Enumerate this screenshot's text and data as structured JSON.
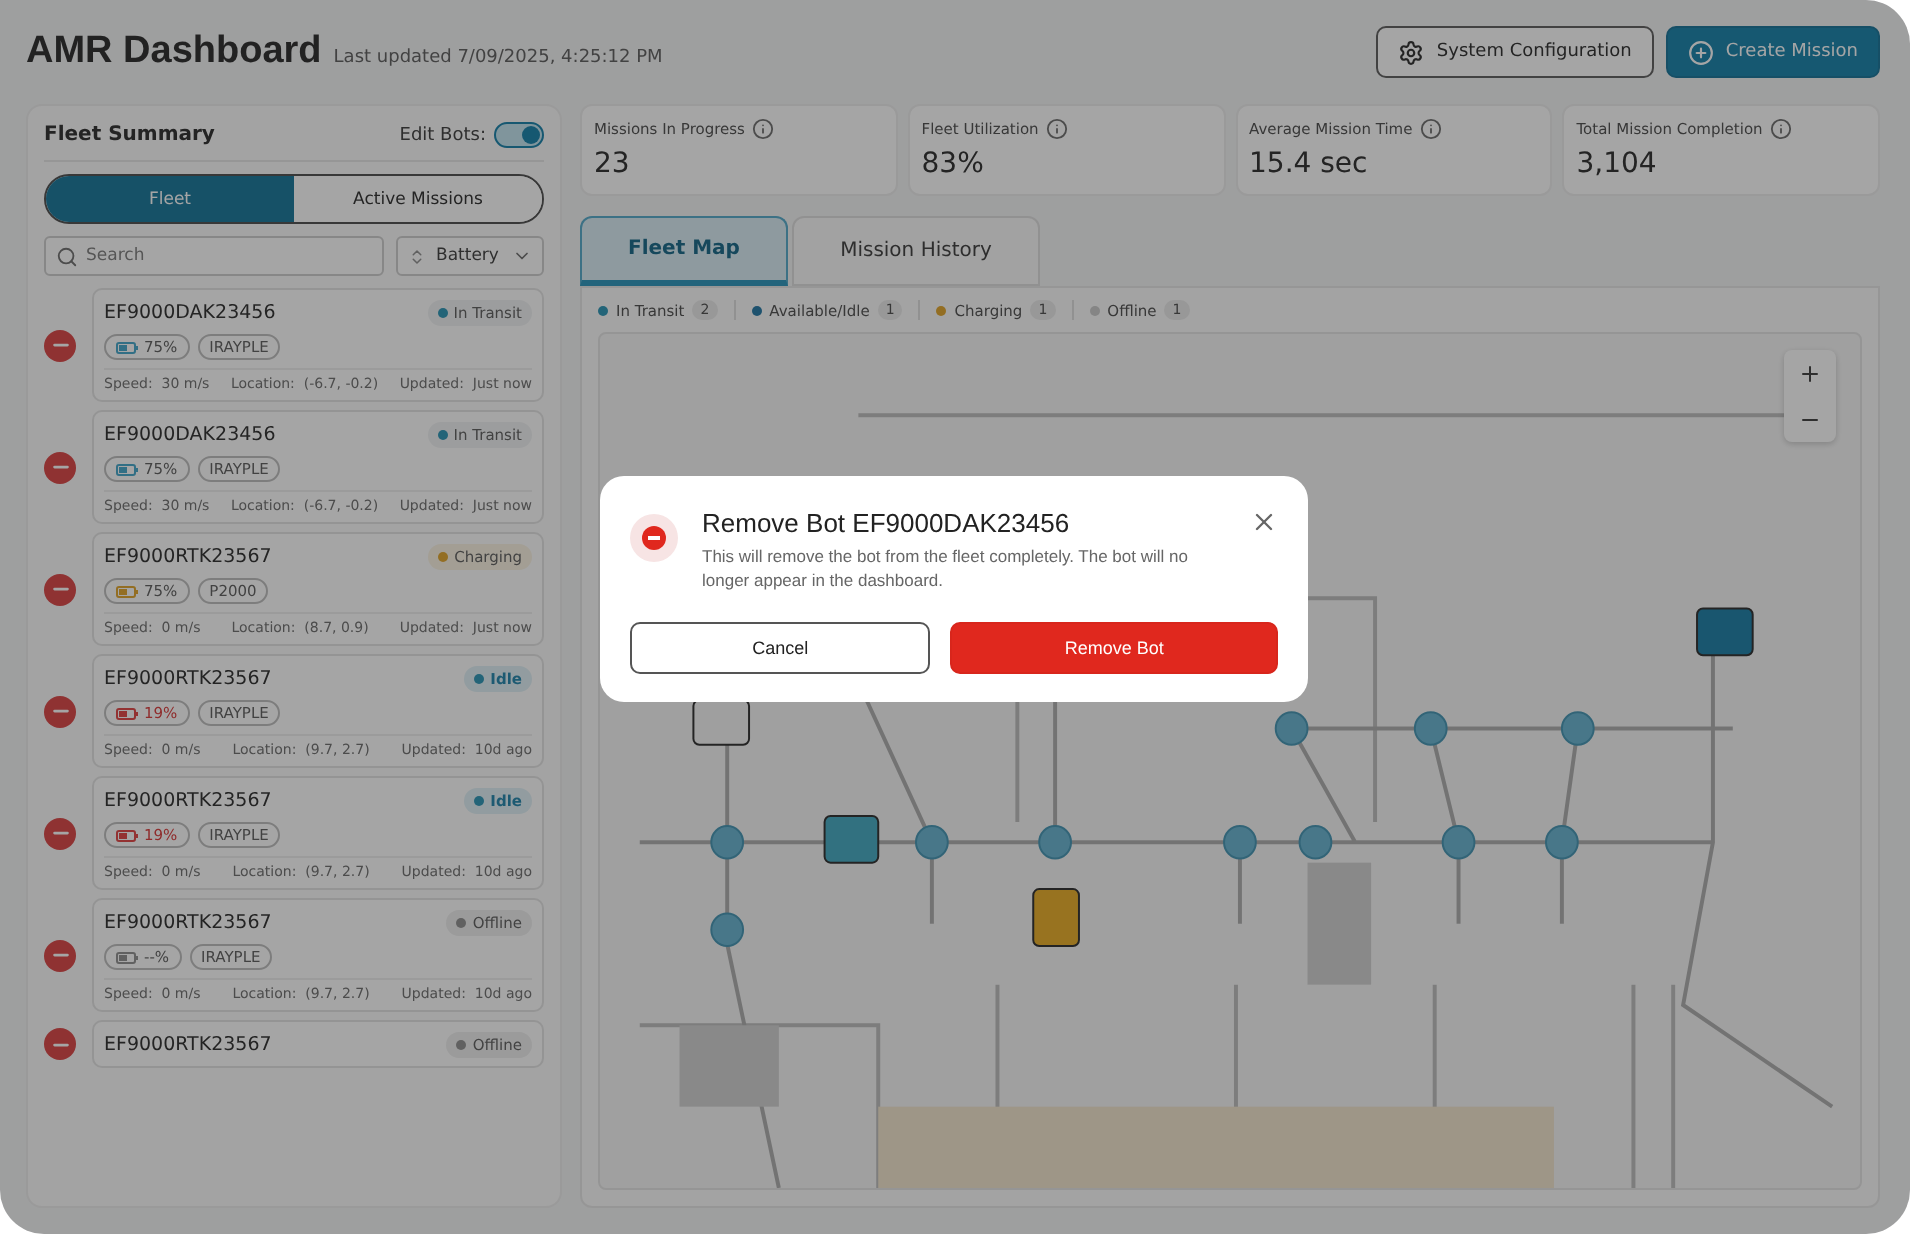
{
  "header": {
    "title": "AMR Dashboard",
    "updated": "Last updated 7/09/2025, 4:25:12 PM",
    "buttons": [
      {
        "label": "System Configuration",
        "kind": "outline"
      },
      {
        "label": "Create Mission",
        "kind": "primary"
      }
    ]
  },
  "fleet": {
    "title": "Fleet Summary",
    "edit_label": "Edit Bots:",
    "edit_on": true,
    "tabs": [
      {
        "label": "Fleet",
        "selected": true
      },
      {
        "label": "Active Missions",
        "selected": false
      }
    ],
    "search": {
      "placeholder": "Search"
    },
    "sort": {
      "value": "Battery"
    },
    "bots": [
      {
        "name": "EF9000DAK23456",
        "status": {
          "label": "In Transit",
          "kind": "transit",
          "color": "#236478"
        },
        "battery": {
          "text": "75%",
          "color": "#326f85",
          "low": false
        },
        "model": "IRAYPLE",
        "speed": "Speed:  30 m/s",
        "location": "Location:  (-6.7, -0.2)",
        "updated": "Updated:  Just now"
      },
      {
        "name": "EF9000DAK23456",
        "status": {
          "label": "In Transit",
          "kind": "transit",
          "color": "#236478"
        },
        "battery": {
          "text": "75%",
          "color": "#326f85",
          "low": false
        },
        "model": "IRAYPLE",
        "speed": "Speed:  30 m/s",
        "location": "Location:  (-6.7, -0.2)",
        "updated": "Updated:  Just now"
      },
      {
        "name": "EF9000RTK23567",
        "status": {
          "label": "Charging",
          "kind": "charging",
          "color": "#936e23"
        },
        "battery": {
          "text": "75%",
          "color": "#936e23",
          "low": false
        },
        "model": "P2000",
        "speed": "Speed:  0 m/s",
        "location": "Location:  (8.7, 0.9)",
        "updated": "Updated:  Just now"
      },
      {
        "name": "EF9000RTK23567",
        "status": {
          "label": "Idle",
          "kind": "idle",
          "color": "#236478"
        },
        "battery": {
          "text": "19%",
          "color": "#933232",
          "low": true
        },
        "model": "IRAYPLE",
        "speed": "Speed:  0 m/s",
        "location": "Location:  (9.7, 2.7)",
        "updated": "Updated:  10d ago"
      },
      {
        "name": "EF9000RTK23567",
        "status": {
          "label": "Idle",
          "kind": "idle",
          "color": "#236478"
        },
        "battery": {
          "text": "19%",
          "color": "#933232",
          "low": true
        },
        "model": "IRAYPLE",
        "speed": "Speed:  0 m/s",
        "location": "Location:  (9.7, 2.7)",
        "updated": "Updated:  10d ago"
      },
      {
        "name": "EF9000RTK23567",
        "status": {
          "label": "Offline",
          "kind": "offline",
          "color": "#616161"
        },
        "battery": {
          "text": "--%",
          "color": "#616161",
          "low": false
        },
        "model": "IRAYPLE",
        "speed": "Speed:  0 m/s",
        "location": "Location:  (9.7, 2.7)",
        "updated": "Updated:  10d ago"
      },
      {
        "name": "EF9000RTK23567",
        "status": {
          "label": "Offline",
          "kind": "offline",
          "color": "#616161"
        }
      }
    ]
  },
  "stats": [
    {
      "label": "Missions In Progress",
      "value": "23"
    },
    {
      "label": "Fleet Utilization",
      "value": "83%"
    },
    {
      "label": "Average Mission Time",
      "value": "15.4 sec"
    },
    {
      "label": "Total Mission Completion",
      "value": "3,104"
    }
  ],
  "view_tabs": [
    {
      "label": "Fleet Map",
      "selected": true
    },
    {
      "label": "Mission History",
      "selected": false
    }
  ],
  "legend": [
    {
      "label": "In Transit",
      "count": "2",
      "color": "#236478"
    },
    {
      "label": "Available/Idle",
      "count": "1",
      "color": "#1e526e"
    },
    {
      "label": "Charging",
      "count": "1",
      "color": "#936e23"
    },
    {
      "label": "Offline",
      "count": "1",
      "color": "#858585"
    }
  ],
  "dialog": {
    "title": "Remove Bot EF9000DAK23456",
    "message": "This will remove the bot from the fleet completely. The bot will no longer appear in the dashboard.",
    "cancel": "Cancel",
    "confirm": "Remove Bot"
  }
}
